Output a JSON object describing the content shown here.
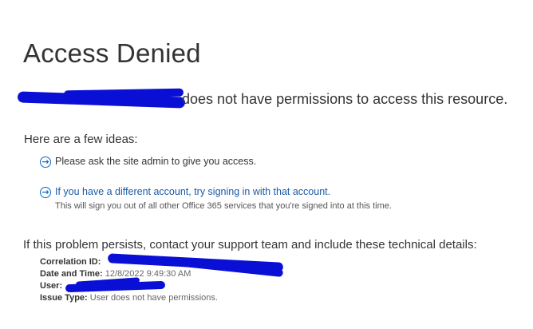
{
  "page": {
    "title": "Access Denied",
    "denied_message": "does not have permissions to access this resource."
  },
  "ideas": {
    "heading": "Here are a few ideas:",
    "items": [
      {
        "icon": "arrow-circle-icon",
        "text": "Please ask the site admin to give you access."
      },
      {
        "icon": "arrow-circle-icon",
        "link_text": "If you have a different account, try signing in with that account.",
        "subtext": "This will sign you out of all other Office 365 services that you're signed into at this time."
      }
    ]
  },
  "technical": {
    "intro": "If this problem persists, contact your support team and include these technical details:",
    "details": [
      {
        "label": "Correlation ID:",
        "value": ""
      },
      {
        "label": "Date and Time:",
        "value": "12/8/2022 9:49:30 AM"
      },
      {
        "label": "User:",
        "value": ""
      },
      {
        "label": "Issue Type:",
        "value": "User does not have permissions."
      }
    ]
  },
  "colors": {
    "link": "#1a5aa8",
    "icon": "#1565c0",
    "redaction": "#0a0fd6",
    "text": "#333333"
  }
}
